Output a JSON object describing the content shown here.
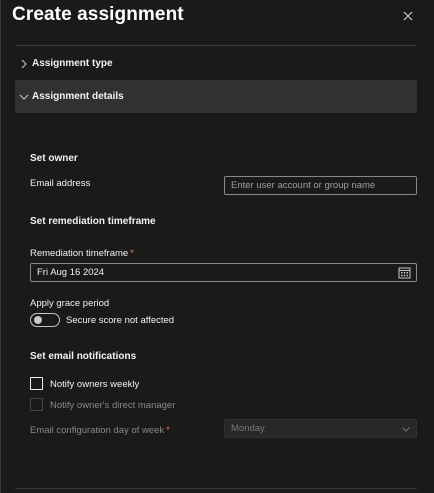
{
  "header": {
    "title": "Create assignment"
  },
  "sections": {
    "assignment_type": "Assignment type",
    "assignment_details": "Assignment details"
  },
  "owner": {
    "heading": "Set owner",
    "email_label": "Email address",
    "email_placeholder": "Enter user account or group name",
    "email_value": ""
  },
  "remediation": {
    "heading": "Set remediation timeframe",
    "timeframe_label": "Remediation timeframe",
    "required_mark": "*",
    "timeframe_value": "Fri Aug 16 2024"
  },
  "grace": {
    "label": "Apply grace period",
    "toggle_text": "Secure score not affected",
    "enabled": false
  },
  "notifications": {
    "heading": "Set email notifications",
    "notify_weekly_label": "Notify owners weekly",
    "notify_weekly_checked": false,
    "notify_manager_label": "Notify owner's direct manager",
    "notify_manager_checked": false,
    "day_label": "Email configuration day of week",
    "required_mark": "*",
    "day_value": "Monday"
  },
  "icons": {
    "close": "close-icon",
    "chevron_right": "chevron-right-icon",
    "chevron_down": "chevron-down-icon",
    "calendar": "calendar-icon"
  },
  "colors": {
    "background": "#1b1a19",
    "expanded_row": "#323130",
    "required": "#f1707b",
    "text": "#f3f2f1",
    "muted": "#8a8886"
  }
}
